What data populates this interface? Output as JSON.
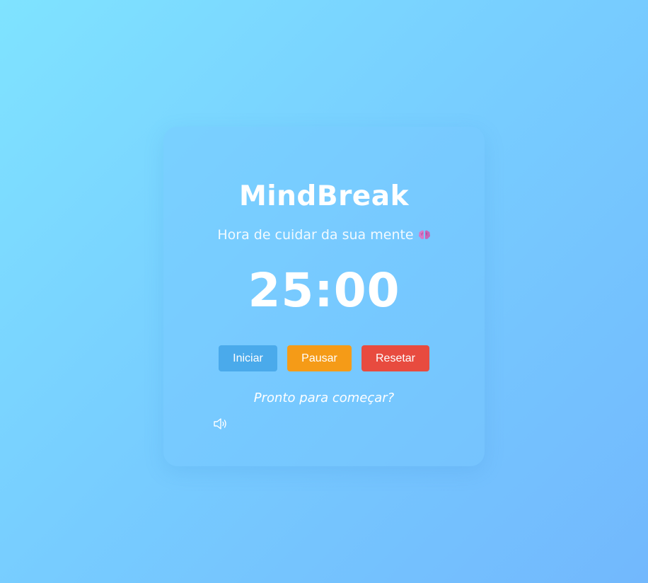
{
  "app": {
    "title": "MindBreak",
    "subtitle": "Hora de cuidar da sua mente"
  },
  "timer": {
    "display": "25:00"
  },
  "controls": {
    "start_label": "Iniciar",
    "pause_label": "Pausar",
    "reset_label": "Resetar"
  },
  "status": {
    "message": "Pronto para começar?"
  },
  "icons": {
    "subtitle_icon": "brain-icon",
    "sound_icon": "speaker-icon"
  },
  "colors": {
    "start": "#4aaaeb",
    "pause": "#f59b17",
    "reset": "#e84b3f"
  }
}
